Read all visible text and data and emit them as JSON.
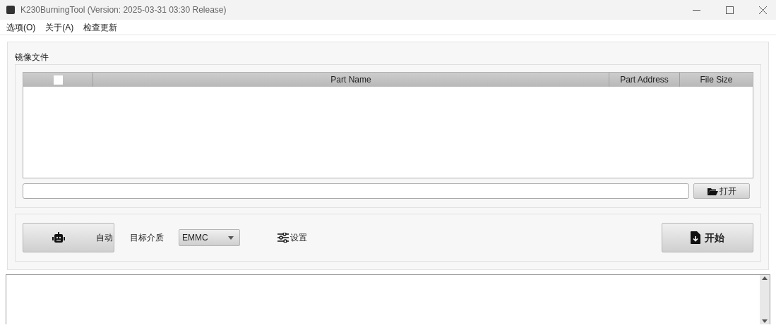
{
  "window": {
    "title": "K230BurningTool (Version: 2025-03-31 03:30 Release)"
  },
  "menu": [
    "选项(O)",
    "关于(A)",
    "检查更新"
  ],
  "image_group": {
    "title": "镜像文件",
    "table": {
      "select_all": {
        "checked": false
      },
      "columns": [
        "Part Name",
        "Part Address",
        "File Size"
      ]
    },
    "open_button": "打开"
  },
  "controls": {
    "auto_button": "自动",
    "target_label": "目标介质",
    "target_select": {
      "value": "EMMC"
    },
    "settings_button": "设置",
    "start_button": "开始"
  }
}
